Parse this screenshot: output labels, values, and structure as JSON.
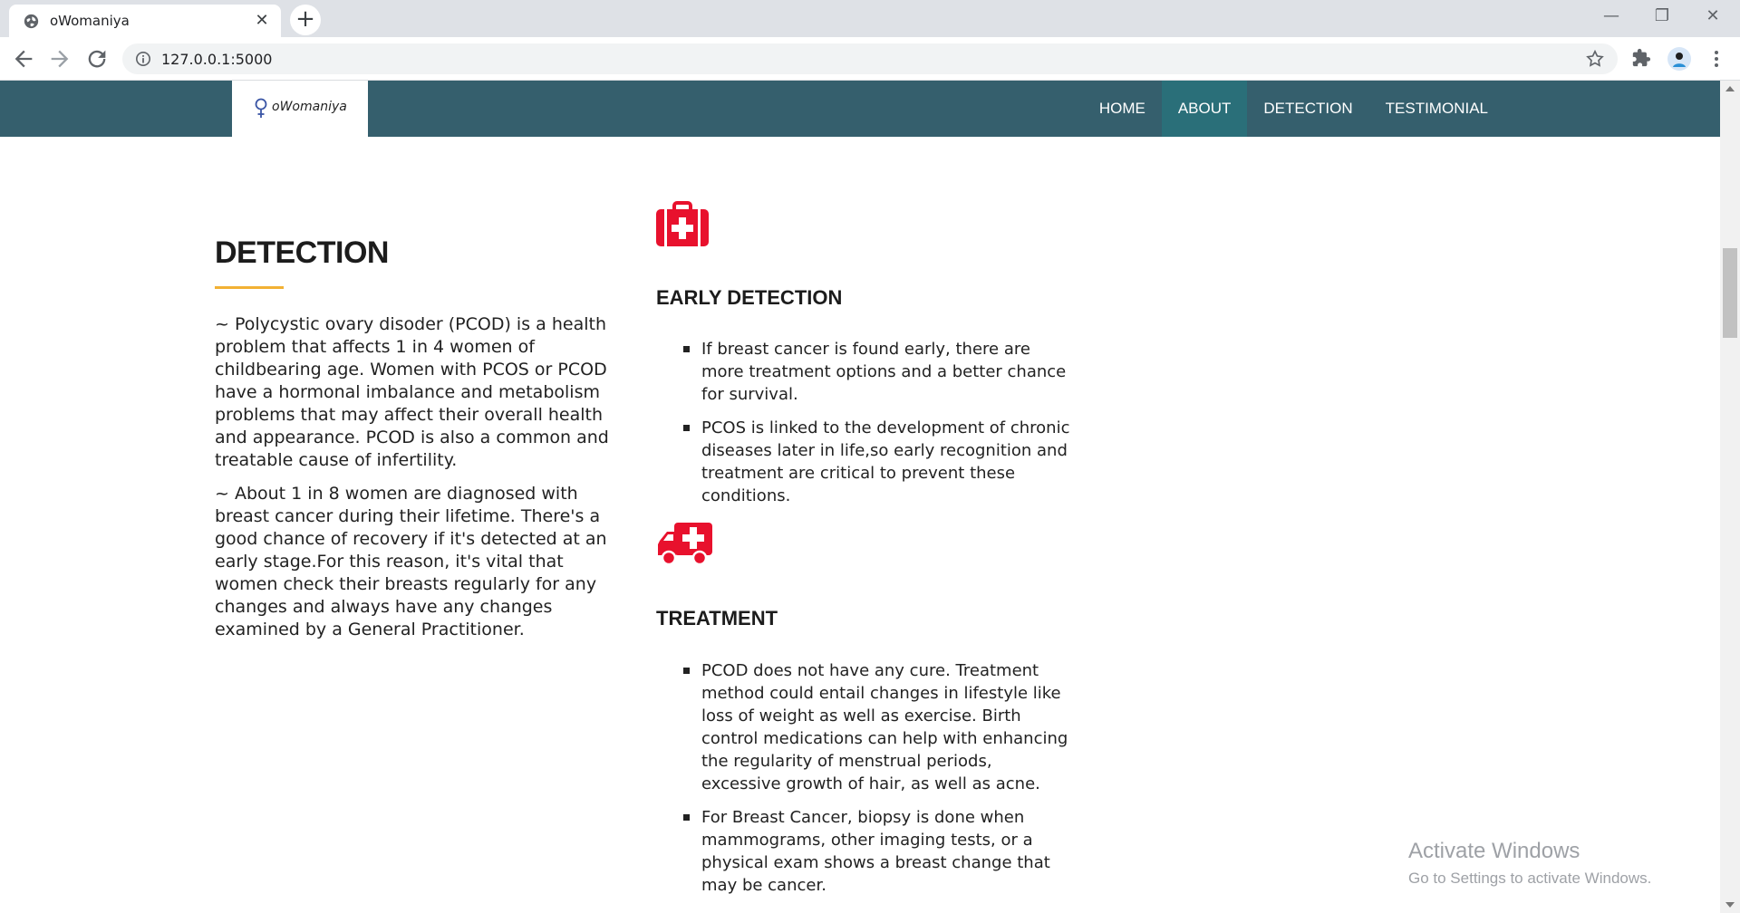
{
  "browser": {
    "tab_title": "oWomaniya",
    "tab_close": "✕",
    "new_tab": "+",
    "url": "127.0.0.1:5000",
    "window_controls": {
      "minimize": "—",
      "restore": "❐",
      "close": "✕"
    }
  },
  "site": {
    "logo_text": "oWomaniya",
    "nav": [
      {
        "label": "HOME"
      },
      {
        "label": "ABOUT",
        "active": true
      },
      {
        "label": "DETECTION"
      },
      {
        "label": "TESTIMONIAL"
      }
    ],
    "colors": {
      "navbar": "#355f6d",
      "active": "#2a6f79",
      "accent_rule": "#f2b134",
      "icon_red": "#e8112d"
    }
  },
  "detection": {
    "title": "DETECTION",
    "paragraphs": [
      "~ Polycystic ovary disoder (PCOD) is a health problem that affects 1 in 4 women of childbearing age. Women with PCOS or PCOD have a hormonal imbalance and metabolism problems that may affect their overall health and appearance. PCOD is also a common and treatable cause of infertility.",
      "~ About 1 in 8 women are diagnosed with breast cancer during their lifetime. There's a good chance of recovery if it's detected at an early stage.For this reason, it's vital that women check their breasts regularly for any changes and always have any changes examined by a General Practitioner."
    ]
  },
  "early_detection": {
    "icon": "medical-kit-icon",
    "title": "EARLY DETECTION",
    "items": [
      "If breast cancer is found early, there are more treatment options and a better chance for survival.",
      "PCOS is linked to the development of chronic diseases later in life,so early recognition and treatment are critical to prevent these conditions."
    ]
  },
  "treatment": {
    "icon": "ambulance-icon",
    "title": "TREATMENT",
    "items": [
      "PCOD does not have any cure. Treatment method could entail changes in lifestyle like loss of weight as well as exercise. Birth control medications can help with enhancing the regularity of menstrual periods, excessive growth of hair, as well as acne.",
      "For Breast Cancer, biopsy is done when mammograms, other imaging tests, or a physical exam shows a breast change that may be cancer."
    ]
  },
  "watermark": {
    "title": "Activate Windows",
    "subtitle": "Go to Settings to activate Windows."
  }
}
